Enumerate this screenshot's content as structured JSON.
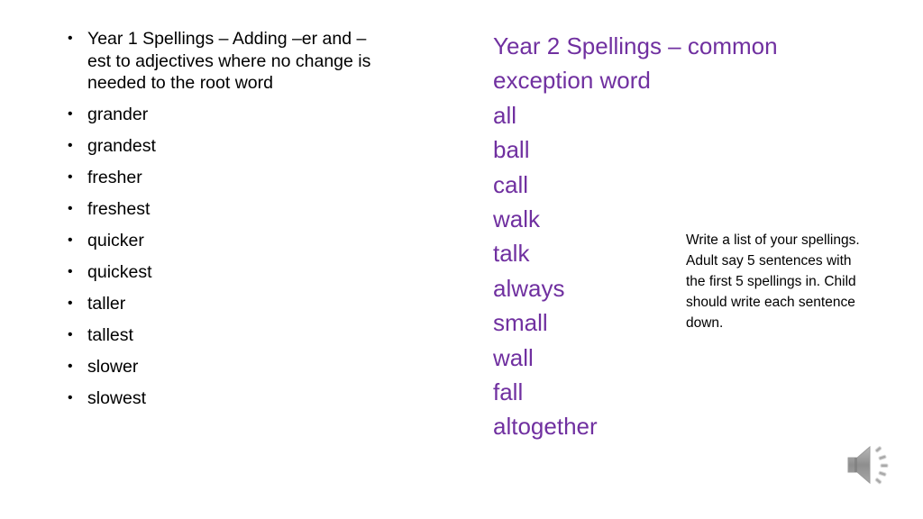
{
  "colors": {
    "accent_purple": "#7030a0",
    "body_text": "#000000",
    "speaker_gray": "#9a9a9a"
  },
  "left": {
    "heading": "Year 1 Spellings – Adding –er and –est to adjectives where no change is needed to the root word",
    "words": [
      "grander",
      "grandest",
      "fresher",
      "freshest",
      "quicker",
      "quickest",
      "taller",
      "tallest",
      "slower",
      "slowest"
    ],
    "bullet": "•"
  },
  "right": {
    "title_line1": "Year 2 Spellings – common",
    "title_line2": "exception word",
    "words": [
      "all",
      "ball",
      "call",
      "walk",
      "talk",
      "always",
      "small",
      "wall",
      "fall",
      "altogether"
    ]
  },
  "instructions": {
    "text": "Write a list of your spellings. Adult say 5 sentences with the first 5 spellings in. Child should write each sentence down."
  },
  "audio": {
    "icon": "speaker-icon"
  }
}
